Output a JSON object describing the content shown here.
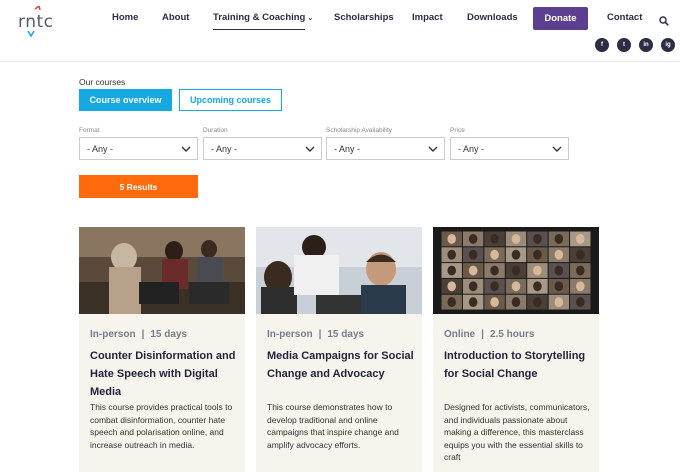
{
  "header": {
    "logo_text": "rntc",
    "nav": [
      {
        "label": "Home"
      },
      {
        "label": "About"
      },
      {
        "label": "Training & Coaching"
      },
      {
        "label": "Scholarships"
      },
      {
        "label": "Impact"
      },
      {
        "label": "Downloads"
      },
      {
        "label": "Contact"
      }
    ],
    "donate_label": "Donate",
    "social": [
      "f",
      "t",
      "in",
      "ig"
    ],
    "colors": {
      "donate": "#5d3f8f",
      "nav_text": "#2c2c44"
    }
  },
  "courses": {
    "section_label": "Our courses",
    "tabs": [
      {
        "label": "Course overview",
        "active": true
      },
      {
        "label": "Upcoming courses",
        "active": false
      }
    ],
    "filters": [
      {
        "label": "Format",
        "value": "- Any -"
      },
      {
        "label": "Duration",
        "value": "- Any -"
      },
      {
        "label": "Scholarship Availability",
        "value": "- Any -"
      },
      {
        "label": "Price",
        "value": "- Any -"
      }
    ],
    "results_label": "5 Results",
    "colors": {
      "tab_active": "#16a8e0",
      "results": "#ff6a0d",
      "card_bg": "#f7f4ee"
    }
  },
  "cards": [
    {
      "format": "In-person",
      "duration": "15 days",
      "title": "Counter Disinformation and Hate Speech with Digital Media",
      "description": "This course provides practical tools to combat disinformation, counter hate speech and polarisation online, and increase outreach in media."
    },
    {
      "format": "In-person",
      "duration": "15 days",
      "title": "Media Campaigns for Social Change and Advocacy",
      "description": "This course demonstrates how to develop traditional and online campaigns that inspire change and amplify advocacy efforts."
    },
    {
      "format": "Online",
      "duration": "2.5 hours",
      "title": "Introduction to Storytelling for Social Change",
      "description": "Designed for activists, communicators, and individuals passionate about making a difference, this masterclass equips you with the essential skills to craft"
    }
  ]
}
